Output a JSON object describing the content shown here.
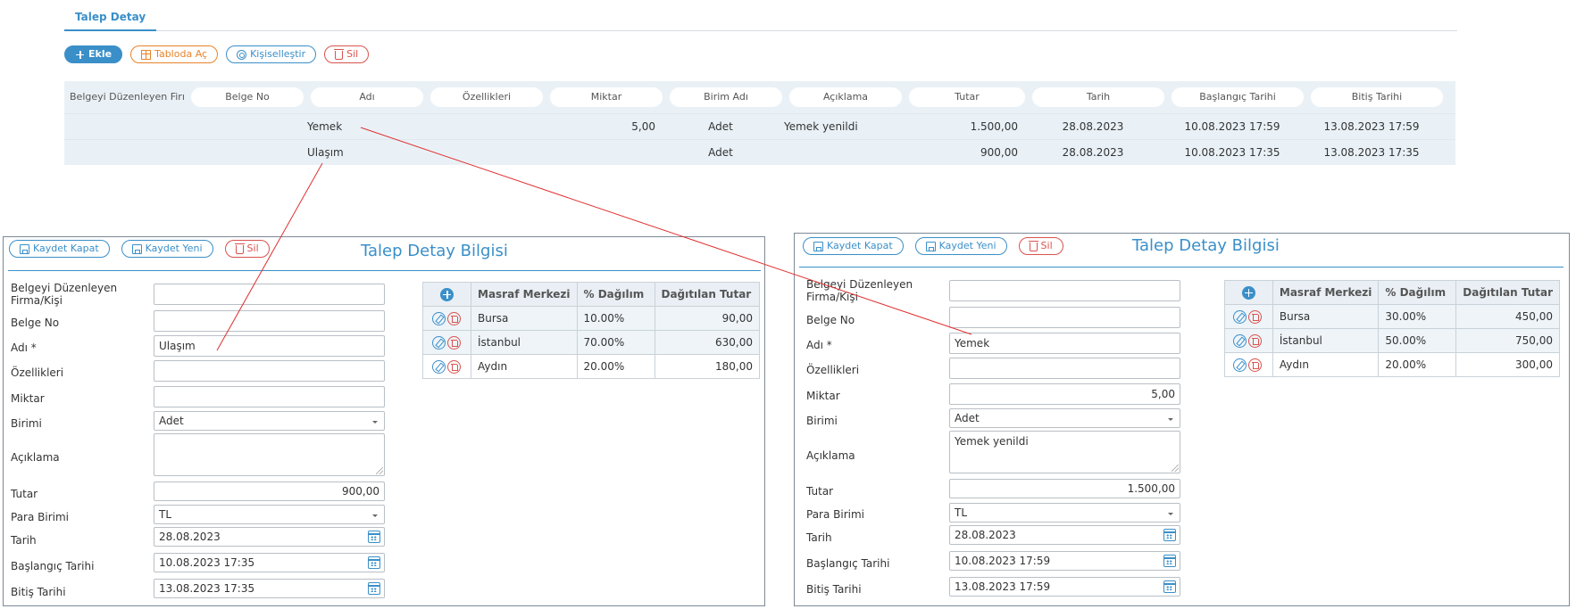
{
  "tab": {
    "label": "Talep Detay"
  },
  "toolbar": {
    "add": "Ekle",
    "table": "Tabloda Aç",
    "customize": "Kişiselleştir",
    "delete": "Sil"
  },
  "grid": {
    "headers": [
      "Belgeyi Düzenleyen Firı",
      "Belge No",
      "Adı",
      "Özellikleri",
      "Miktar",
      "Birim Adı",
      "Açıklama",
      "Tutar",
      "Tarih",
      "Başlangıç Tarihi",
      "Bitiş Tarihi"
    ],
    "rows": [
      {
        "firma": "",
        "belge_no": "",
        "adi": "Yemek",
        "ozellikleri": "",
        "miktar": "5,00",
        "birim": "Adet",
        "aciklama": "Yemek yenildi",
        "tutar": "1.500,00",
        "tarih": "28.08.2023",
        "baslangic": "10.08.2023 17:59",
        "bitis": "13.08.2023 17:59"
      },
      {
        "firma": "",
        "belge_no": "",
        "adi": "Ulaşım",
        "ozellikleri": "",
        "miktar": "",
        "birim": "Adet",
        "aciklama": "",
        "tutar": "900,00",
        "tarih": "28.08.2023",
        "baslangic": "10.08.2023 17:35",
        "bitis": "13.08.2023 17:35"
      }
    ]
  },
  "labels": {
    "save_close": "Kaydet Kapat",
    "save_new": "Kaydet Yeni",
    "delete": "Sil",
    "panel_title": "Talep Detay Bilgisi",
    "firma_line1": "Belgeyi Düzenleyen",
    "firma_line2": "Firma/Kişi",
    "belge_no": "Belge No",
    "adi": "Adı *",
    "ozellikleri": "Özellikleri",
    "miktar": "Miktar",
    "birimi": "Birimi",
    "aciklama": "Açıklama",
    "tutar": "Tutar",
    "para_birimi": "Para Birimi",
    "tarih": "Tarih",
    "baslangic": "Başlangıç Tarihi",
    "bitis": "Bitiş Tarihi",
    "col_masraf": "Masraf Merkezi",
    "col_dagilim": "% Dağılım",
    "col_tutar": "Dağıtılan Tutar"
  },
  "left_panel": {
    "firma": "",
    "belge_no": "",
    "adi": "Ulaşım",
    "ozellikleri": "",
    "miktar": "",
    "birimi": "Adet",
    "aciklama": "",
    "tutar": "900,00",
    "para_birimi": "TL",
    "tarih": "28.08.2023",
    "baslangic": "10.08.2023 17:35",
    "bitis": "13.08.2023 17:35",
    "cost_centers": [
      {
        "name": "Bursa",
        "pct": "10.00%",
        "amount": "90,00"
      },
      {
        "name": "İstanbul",
        "pct": "70.00%",
        "amount": "630,00"
      },
      {
        "name": "Aydın",
        "pct": "20.00%",
        "amount": "180,00"
      }
    ]
  },
  "right_panel": {
    "firma": "",
    "belge_no": "",
    "adi": "Yemek",
    "ozellikleri": "",
    "miktar": "5,00",
    "birimi": "Adet",
    "aciklama": "Yemek yenildi",
    "tutar": "1.500,00",
    "para_birimi": "TL",
    "tarih": "28.08.2023",
    "baslangic": "10.08.2023 17:59",
    "bitis": "13.08.2023 17:59",
    "cost_centers": [
      {
        "name": "Bursa",
        "pct": "30.00%",
        "amount": "450,00"
      },
      {
        "name": "İstanbul",
        "pct": "50.00%",
        "amount": "750,00"
      },
      {
        "name": "Aydın",
        "pct": "20.00%",
        "amount": "300,00"
      }
    ]
  },
  "colors": {
    "accent": "#3a8fc9",
    "danger": "#d9534f",
    "warning": "#e8832a",
    "annotation_line": "#e03030"
  }
}
